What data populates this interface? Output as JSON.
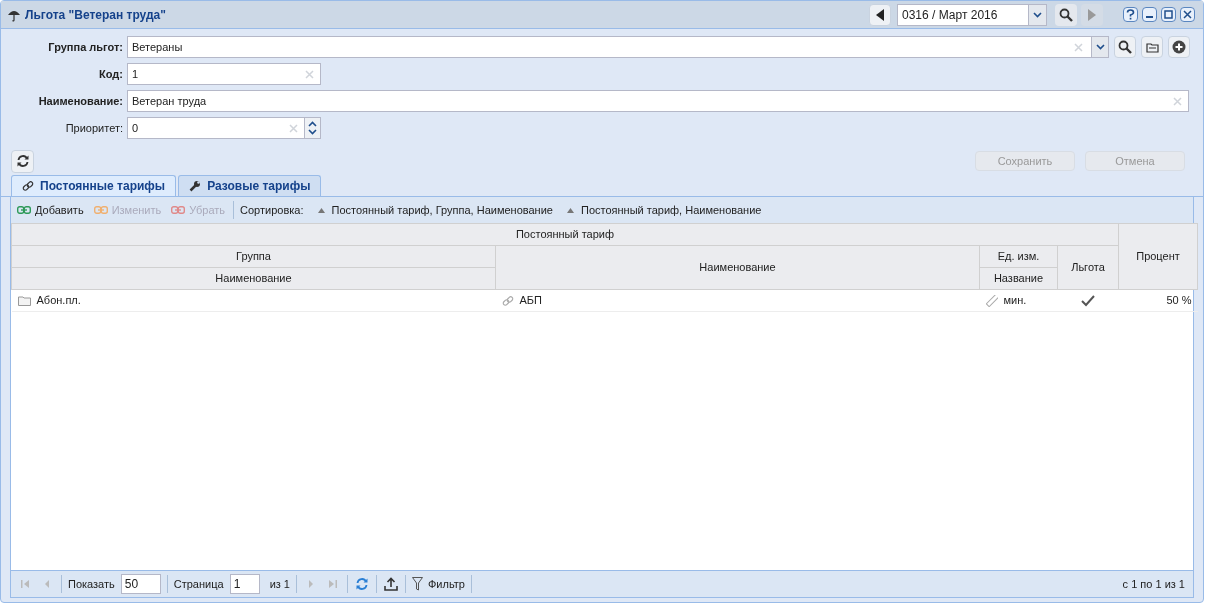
{
  "window": {
    "title": "Льгота \"Ветеран труда\""
  },
  "period": {
    "value": "0316 / Март 2016"
  },
  "fields": [
    {
      "label": "Группа льгот:",
      "value": "Ветераны",
      "bold": true,
      "kind": "combo"
    },
    {
      "label": "Код:",
      "value": "1",
      "bold": true,
      "kind": "short"
    },
    {
      "label": "Наименование:",
      "value": "Ветеран труда",
      "bold": true,
      "kind": "text"
    },
    {
      "label": "Приоритет:",
      "value": "0",
      "bold": false,
      "kind": "spinner"
    }
  ],
  "actions": [
    {
      "label": "Сохранить",
      "disabled": true
    },
    {
      "label": "Отмена",
      "disabled": true
    }
  ],
  "tabs": [
    {
      "label": "Постоянные тарифы",
      "selected": true,
      "kind": "link"
    },
    {
      "label": "Разовые тарифы",
      "selected": false,
      "kind": "wrench"
    }
  ],
  "toolbar": [
    {
      "label": "Добавить",
      "disabled": false,
      "color": "#2e9a5a"
    },
    {
      "label": "Изменить",
      "disabled": true,
      "color": "#f0b070"
    },
    {
      "label": "Убрать",
      "disabled": true,
      "color": "#e08a8a"
    }
  ],
  "sort": {
    "label": "Сортировка:",
    "items": [
      "Постоянный тариф, Группа, Наименование",
      "Постоянный тариф, Наименование"
    ]
  },
  "grid": {
    "group_header": "Постоянный тариф",
    "columns": {
      "group": "Группа",
      "group_name": "Наименование",
      "name": "Наименование",
      "unit": "Ед. изм.",
      "unit_name": "Название",
      "benefit": "Льгота",
      "percent": "Процент"
    },
    "rows": [
      {
        "group_name": "Абон.пл.",
        "name": "АБП",
        "unit_name": "мин.",
        "benefit": true,
        "percent": "50 %"
      }
    ]
  },
  "pager": {
    "show_label": "Показать",
    "page_size": "50",
    "page_label": "Страница",
    "page": "1",
    "of": "из 1",
    "filter": "Фильтр",
    "summary": "с 1 по 1 из 1"
  }
}
